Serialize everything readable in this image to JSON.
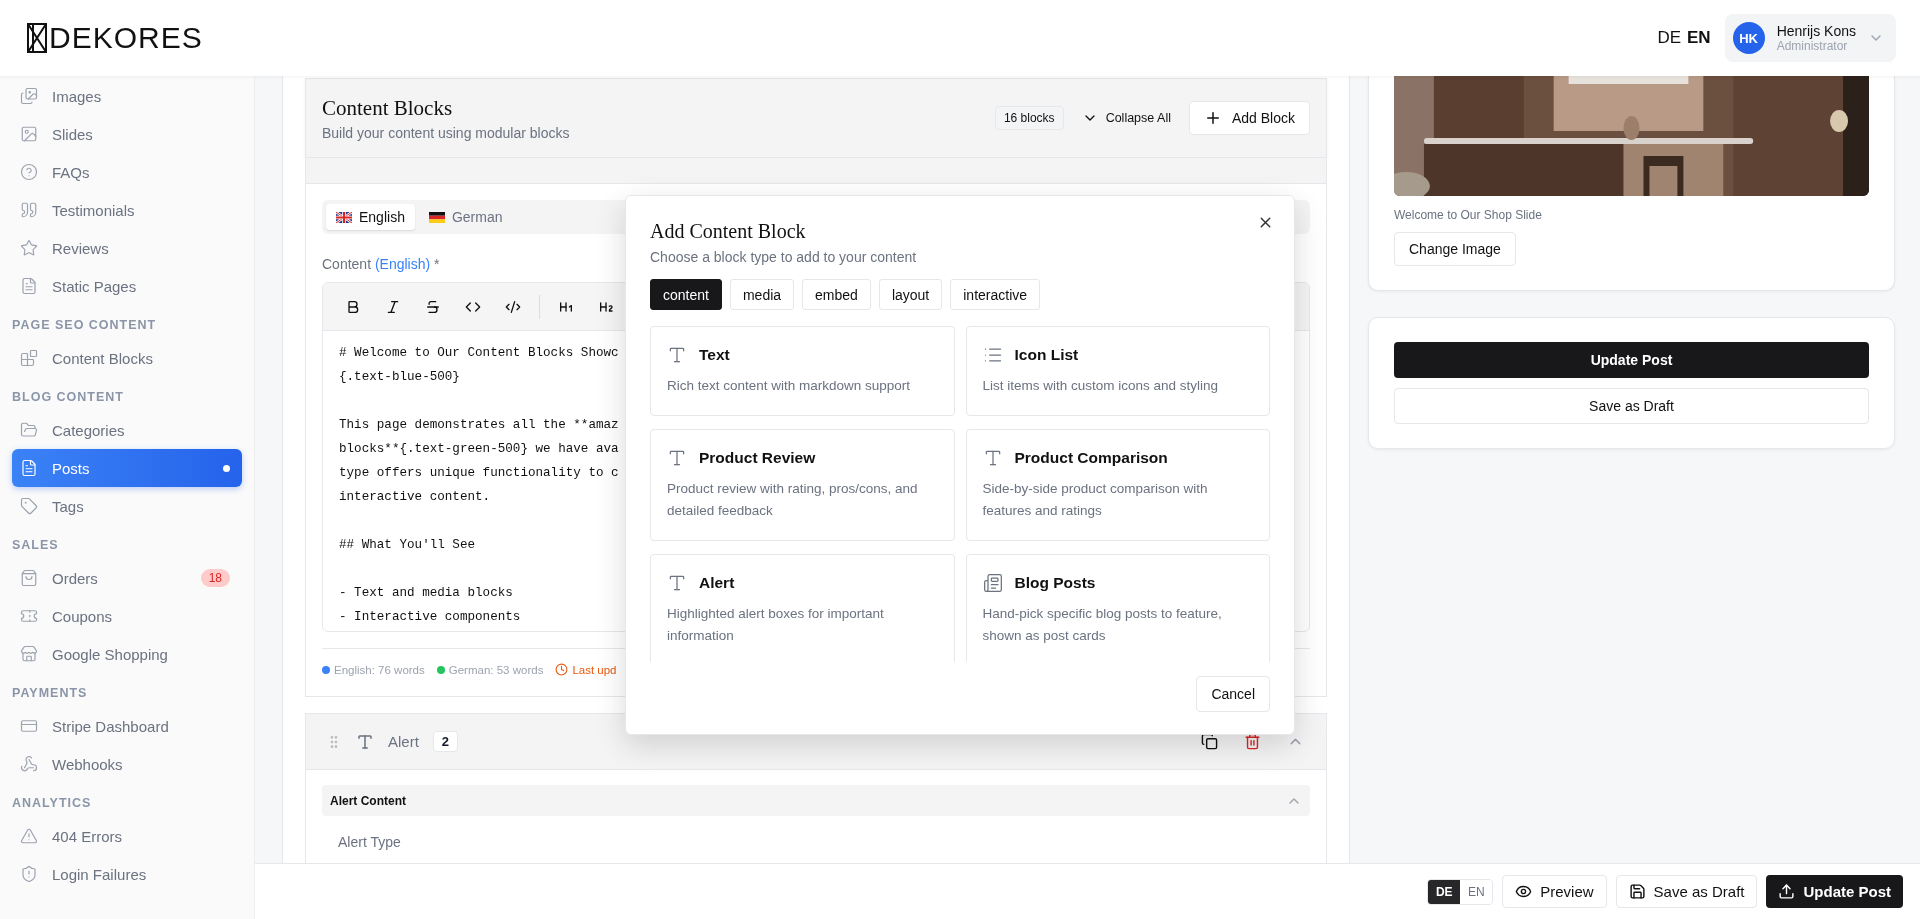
{
  "logo": {
    "text": "DEKORES"
  },
  "header": {
    "languages": [
      {
        "label": "DE",
        "selected": false
      },
      {
        "label": "EN",
        "selected": true
      }
    ],
    "user": {
      "initials": "HK",
      "name": "Henrijs Kons",
      "role": "Administrator"
    }
  },
  "sidebar": {
    "sections": [
      {
        "items": [
          {
            "label": "Images",
            "selected": false
          },
          {
            "label": "Slides",
            "selected": false
          },
          {
            "label": "FAQs",
            "selected": false
          },
          {
            "label": "Testimonials",
            "selected": false
          },
          {
            "label": "Reviews",
            "selected": false
          },
          {
            "label": "Static Pages",
            "selected": false
          }
        ]
      },
      {
        "title": "PAGE SEO CONTENT",
        "items": [
          {
            "label": "Content Blocks",
            "selected": false
          }
        ]
      },
      {
        "title": "BLOG CONTENT",
        "items": [
          {
            "label": "Categories",
            "selected": false
          },
          {
            "label": "Posts",
            "selected": true
          },
          {
            "label": "Tags",
            "selected": false
          }
        ]
      },
      {
        "title": "SALES",
        "items": [
          {
            "label": "Orders",
            "selected": false,
            "badge": "18"
          },
          {
            "label": "Coupons",
            "selected": false
          },
          {
            "label": "Google Shopping",
            "selected": false
          }
        ]
      },
      {
        "title": "PAYMENTS",
        "items": [
          {
            "label": "Stripe Dashboard",
            "selected": false
          },
          {
            "label": "Webhooks",
            "selected": false
          }
        ]
      },
      {
        "title": "ANALYTICS",
        "items": [
          {
            "label": "404 Errors",
            "selected": false
          },
          {
            "label": "Login Failures",
            "selected": false
          }
        ]
      }
    ]
  },
  "content_blocks": {
    "title": "Content Blocks",
    "subtitle": "Build your content using modular blocks",
    "count": "16 blocks",
    "collapse_label": "Collapse All",
    "add_label": "Add Block"
  },
  "text_block": {
    "language_tabs": [
      {
        "label": "English",
        "selected": true
      },
      {
        "label": "German",
        "selected": false
      }
    ],
    "content_label": "Content",
    "content_language": "(English)",
    "required": "*",
    "editor_paragraphs": [
      [
        "# Welcome to Our Content Blocks Showc",
        "{.text-blue-500}"
      ],
      [
        "This page demonstrates all the **amaz",
        "blocks**{.text-green-500} we have ava",
        "type offers unique functionality to c",
        "interactive content."
      ],
      [
        "## What You'll See"
      ],
      [
        "- Text and media blocks",
        "- Interactive components"
      ]
    ],
    "stats": [
      {
        "kind": "dot",
        "label": "English: 76 words",
        "color": "#3b82f6"
      },
      {
        "kind": "dot",
        "label": "German: 53 words",
        "color": "#22c55e"
      },
      {
        "kind": "time",
        "label": "Last upd"
      }
    ]
  },
  "alert_block": {
    "title": "Alert",
    "number": "2",
    "expanded": true,
    "section": {
      "title": "Alert Content",
      "expanded": true
    },
    "field_label": "Alert Type"
  },
  "side_panel": {
    "image_caption": "Welcome to Our Shop Slide",
    "change_image": "Change Image",
    "update": "Update Post",
    "draft": "Save as Draft"
  },
  "bottom_bar": {
    "languages": [
      {
        "label": "DE",
        "selected": true
      },
      {
        "label": "EN",
        "selected": false
      }
    ],
    "preview": "Preview",
    "save_draft": "Save as Draft",
    "update": "Update Post"
  },
  "modal": {
    "title": "Add Content Block",
    "subtitle": "Choose a block type to add to your content",
    "categories": [
      {
        "label": "content",
        "selected": true
      },
      {
        "label": "media",
        "selected": false
      },
      {
        "label": "embed",
        "selected": false
      },
      {
        "label": "layout",
        "selected": false
      },
      {
        "label": "interactive",
        "selected": false
      }
    ],
    "blocks": [
      {
        "title": "Text",
        "description": "Rich text content with markdown support"
      },
      {
        "title": "Icon List",
        "description": "List items with custom icons and styling"
      },
      {
        "title": "Product Review",
        "description": "Product review with rating, pros/cons, and detailed feedback"
      },
      {
        "title": "Product Comparison",
        "description": "Side-by-side product comparison with features and ratings"
      },
      {
        "title": "Alert",
        "description": "Highlighted alert boxes for important information"
      },
      {
        "title": "Blog Posts",
        "description": "Hand-pick specific blog posts to feature, shown as post cards"
      }
    ],
    "cancel": "Cancel"
  }
}
